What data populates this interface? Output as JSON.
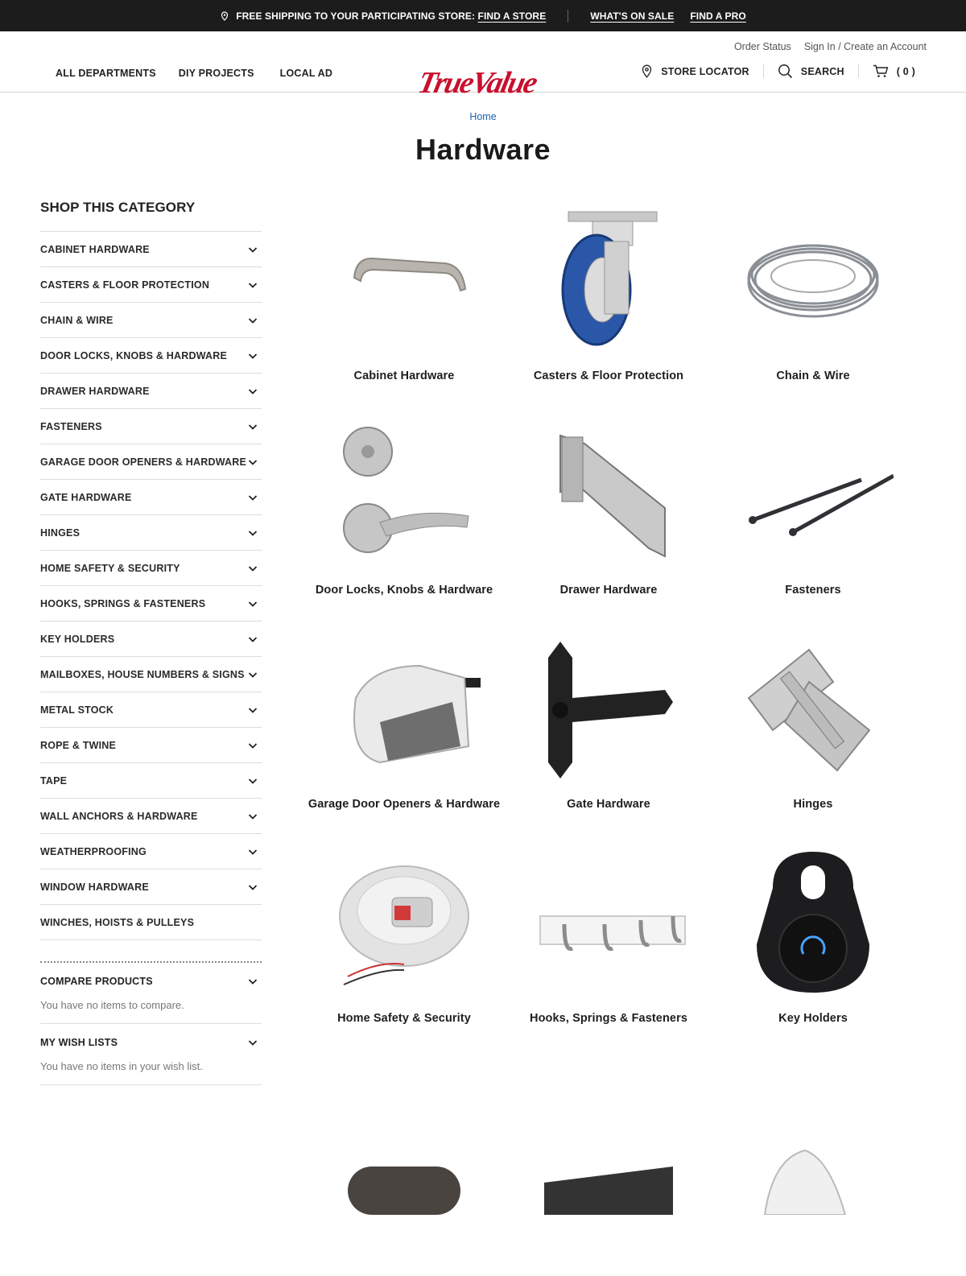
{
  "promo": {
    "shipping_text": "FREE SHIPPING TO YOUR PARTICIPATING STORE:",
    "find_store": "FIND A STORE",
    "on_sale": "WHAT'S ON SALE",
    "find_pro": "FIND A PRO"
  },
  "util": {
    "order_status": "Order Status",
    "sign_in": "Sign In / Create an Account"
  },
  "nav": {
    "departments": "ALL DEPARTMENTS",
    "diy": "DIY PROJECTS",
    "local_ad": "LOCAL AD"
  },
  "logo": {
    "text": "TrueValue",
    "color": "#c8102e"
  },
  "rnav": {
    "store_locator": "STORE LOCATOR",
    "search": "SEARCH",
    "cart_count": "( 0 )"
  },
  "breadcrumb": "Home",
  "title": "Hardware",
  "sidebar": {
    "heading": "SHOP THIS CATEGORY",
    "categories": [
      "CABINET HARDWARE",
      "CASTERS & FLOOR PROTECTION",
      "CHAIN & WIRE",
      "DOOR LOCKS, KNOBS & HARDWARE",
      "DRAWER HARDWARE",
      "FASTENERS",
      "GARAGE DOOR OPENERS & HARDWARE",
      "GATE HARDWARE",
      "HINGES",
      "HOME SAFETY & SECURITY",
      "HOOKS, SPRINGS & FASTENERS",
      "KEY HOLDERS",
      "MAILBOXES, HOUSE NUMBERS & SIGNS",
      "METAL STOCK",
      "ROPE & TWINE",
      "TAPE",
      "WALL ANCHORS & HARDWARE",
      "WEATHERPROOFING",
      "WINDOW HARDWARE",
      "WINCHES, HOISTS & PULLEYS"
    ],
    "compare": {
      "title": "COMPARE PRODUCTS",
      "body": "You have no items to compare."
    },
    "wishlist": {
      "title": "MY WISH LISTS",
      "body": "You have no items in your wish list."
    }
  },
  "tiles": [
    {
      "label": "Cabinet Hardware",
      "icon": "cabinet-pull-icon"
    },
    {
      "label": "Casters & Floor Protection",
      "icon": "caster-wheel-icon"
    },
    {
      "label": "Chain & Wire",
      "icon": "wire-coil-icon"
    },
    {
      "label": "Door Locks, Knobs & Hardware",
      "icon": "door-lock-icon"
    },
    {
      "label": "Drawer Hardware",
      "icon": "drawer-bracket-icon"
    },
    {
      "label": "Fasteners",
      "icon": "nails-icon"
    },
    {
      "label": "Garage Door Openers & Hardware",
      "icon": "garage-opener-icon"
    },
    {
      "label": "Gate Hardware",
      "icon": "gate-hinge-icon"
    },
    {
      "label": "Hinges",
      "icon": "hinge-icon"
    },
    {
      "label": "Home Safety & Security",
      "icon": "smoke-detector-icon"
    },
    {
      "label": "Hooks, Springs & Fasteners",
      "icon": "hook-rack-icon"
    },
    {
      "label": "Key Holders",
      "icon": "key-lockbox-icon"
    },
    {
      "label": "",
      "icon": "mailbox-icon"
    },
    {
      "label": "",
      "icon": "metal-stock-icon"
    },
    {
      "label": "",
      "icon": "rope-icon"
    }
  ]
}
